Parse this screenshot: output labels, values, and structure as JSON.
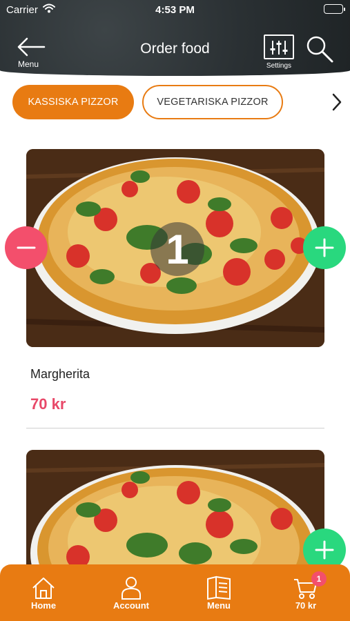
{
  "status_bar": {
    "carrier": "Carrier",
    "time": "4:53 PM"
  },
  "header": {
    "back_label": "Menu",
    "title": "Order food",
    "settings_label": "Settings"
  },
  "categories": {
    "items": [
      "KASSISKA PIZZOR",
      "VEGETARISKA PIZZOR"
    ],
    "active_index": 0
  },
  "foods": [
    {
      "name": "Margherita",
      "price": "70 kr",
      "quantity": "1"
    },
    {
      "name": "",
      "price": "",
      "quantity": ""
    }
  ],
  "bottom_nav": {
    "items": [
      {
        "label": "Home",
        "icon": "home-icon"
      },
      {
        "label": "Account",
        "icon": "user-icon"
      },
      {
        "label": "Menu",
        "icon": "menu-book-icon"
      },
      {
        "label": "70 kr",
        "icon": "cart-icon"
      }
    ],
    "cart_count": "1"
  },
  "colors": {
    "accent": "#e87b12",
    "price": "#e84868",
    "minus": "#f34f6c",
    "plus": "#29d87e",
    "header_bg": "#2a3033"
  }
}
